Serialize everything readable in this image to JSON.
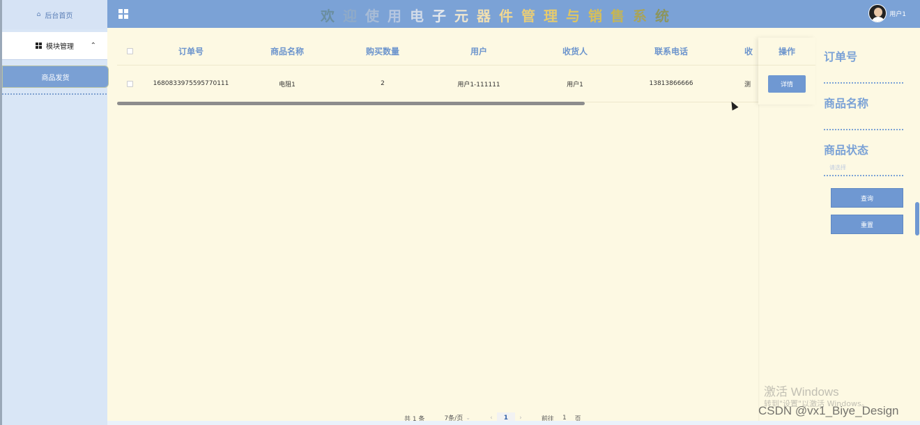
{
  "sidebar": {
    "home_label": "后台首页",
    "module_label": "模块管理",
    "sub_items": [
      {
        "label": "商品发货"
      }
    ]
  },
  "header": {
    "title_chars": [
      {
        "ch": "欢",
        "color": "#6a8ea0"
      },
      {
        "ch": "迎",
        "color": "#8faac8"
      },
      {
        "ch": "使",
        "color": "#a8bcd6"
      },
      {
        "ch": "用",
        "color": "#b5c6e0"
      },
      {
        "ch": "电",
        "color": "#d2dbe8"
      },
      {
        "ch": "子",
        "color": "#e6e9ec"
      },
      {
        "ch": "元",
        "color": "#efe7cf"
      },
      {
        "ch": "器",
        "color": "#f1dfb0"
      },
      {
        "ch": "件",
        "color": "#f0d791"
      },
      {
        "ch": "管",
        "color": "#e8cd78"
      },
      {
        "ch": "理",
        "color": "#e6cb6e"
      },
      {
        "ch": "与",
        "color": "#e0c660"
      },
      {
        "ch": "销",
        "color": "#d8bf57"
      },
      {
        "ch": "售",
        "color": "#c5b555"
      },
      {
        "ch": "系",
        "color": "#a9a45a"
      },
      {
        "ch": "统",
        "color": "#8c955e"
      }
    ],
    "username": "用户1"
  },
  "table": {
    "columns": [
      "订单号",
      "商品名称",
      "购买数量",
      "用户",
      "收货人",
      "联系电话",
      "收"
    ],
    "ops_header": "操作",
    "rows": [
      {
        "order_no": "1680833975595770111",
        "product_name": "电阻1",
        "quantity": "2",
        "user": "用户1-111111",
        "receiver": "用户1",
        "phone": "13813866666",
        "more": "测",
        "detail_label": "详情"
      }
    ]
  },
  "search": {
    "order_label": "订单号",
    "product_label": "商品名称",
    "status_label": "商品状态",
    "status_placeholder": "请选择",
    "query_button": "查询",
    "reset_button": "重置"
  },
  "pagination": {
    "total": "共 1 条",
    "page_size": "7条/页",
    "current_page": "1",
    "goto_label": "前往",
    "goto_value": "1",
    "page_unit": "页"
  },
  "watermarks": {
    "windows_line1": "激活 Windows",
    "windows_line2": "转到\"设置\"以激活 Windows。",
    "csdn": "CSDN @vx1_Biye_Design"
  }
}
